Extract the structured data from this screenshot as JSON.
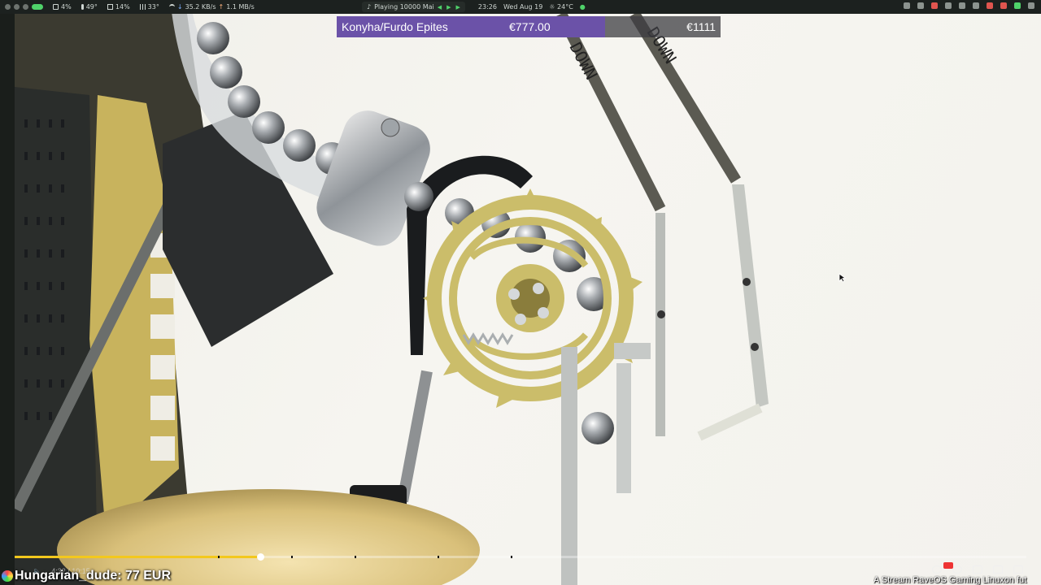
{
  "statusbar": {
    "cpu": "4%",
    "temp": "49°",
    "mem": "14%",
    "gpu_temp": "33°",
    "net_down": "35.2 KB/s",
    "net_up": "1.1 MB/s",
    "now_playing": "Playing 10000 Mai",
    "clock": "23:26",
    "date": "Wed Aug 19",
    "weather": "24°C"
  },
  "overlay": {
    "title": "Konyha/Furdo Epites",
    "current": "€777.00",
    "goal": "€1111",
    "progress_fraction": 0.7
  },
  "player": {
    "time": "4:32 / 10:15",
    "progress_fraction": 0.243,
    "accent": "#f3c81d"
  },
  "donor": {
    "text": "Hungarian_dude: 77 EUR"
  },
  "ticker": {
    "text": "A Stream RaveOS Gaming Linuxon fut"
  },
  "video": {
    "labels": [
      "DOWN",
      "DOWN"
    ]
  }
}
